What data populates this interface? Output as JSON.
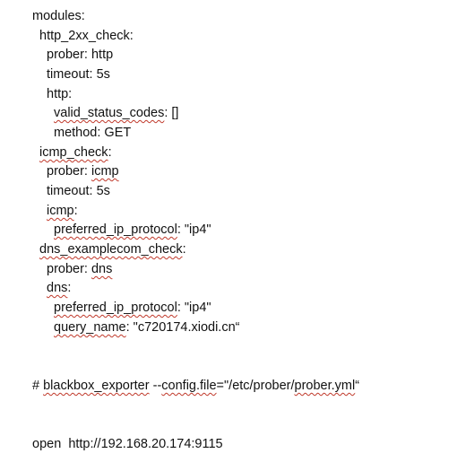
{
  "document": {
    "lines": [
      {
        "segments": [
          "modules:"
        ]
      },
      {
        "segments": [
          "http_2xx_check:"
        ]
      },
      {
        "segments": [
          "prober: http"
        ]
      },
      {
        "segments": [
          "timeout: 5s"
        ]
      },
      {
        "segments": [
          "http:"
        ]
      },
      {
        "segments": [
          "valid_status_codes",
          ": []"
        ]
      },
      {
        "segments": [
          "method: GET"
        ]
      },
      {
        "segments": [
          "icmp_check",
          ":"
        ]
      },
      {
        "segments": [
          "prober: ",
          "icmp"
        ]
      },
      {
        "segments": [
          "timeout: 5s"
        ]
      },
      {
        "segments": [
          "icmp",
          ":"
        ]
      },
      {
        "segments": [
          "preferred_ip_protocol",
          ": \"ip4\""
        ]
      },
      {
        "segments": [
          "dns_examplecom_check",
          ":"
        ]
      },
      {
        "segments": [
          "prober: ",
          "dns"
        ]
      },
      {
        "segments": [
          "dns",
          ":"
        ]
      },
      {
        "segments": [
          "preferred_ip_protocol",
          ": \"ip4\""
        ]
      },
      {
        "segments": [
          "query_name",
          ": \"c720174.xiodi.cn“"
        ]
      },
      {
        "segments": [
          "# ",
          "blackbox_exporter",
          " --",
          "config.file",
          "=\"/etc/prober/",
          "prober.yml",
          "“"
        ]
      },
      {
        "segments": [
          "open  http://192.168.20.174:9115"
        ]
      }
    ]
  }
}
